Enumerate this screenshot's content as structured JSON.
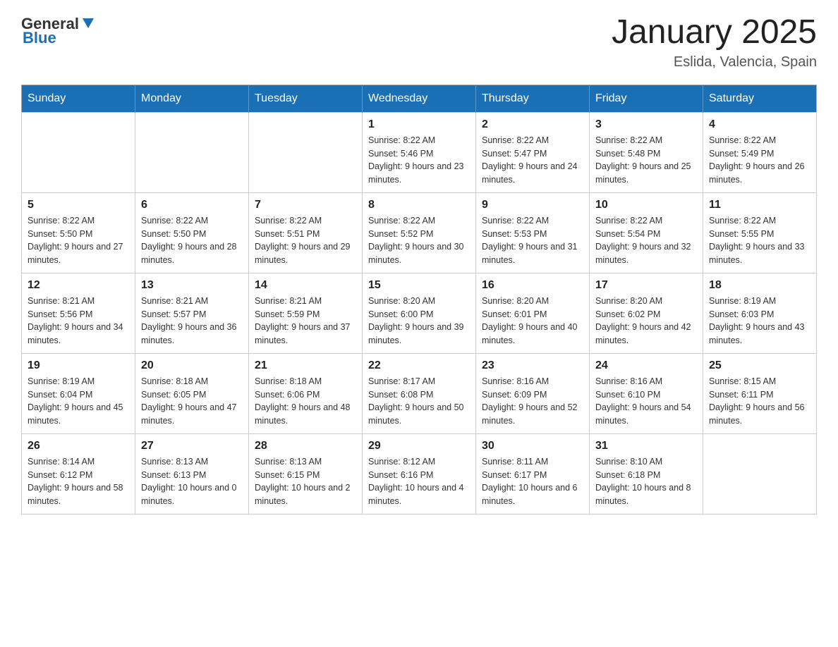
{
  "logo": {
    "text_general": "General",
    "text_blue": "Blue"
  },
  "title": "January 2025",
  "location": "Eslida, Valencia, Spain",
  "days_of_week": [
    "Sunday",
    "Monday",
    "Tuesday",
    "Wednesday",
    "Thursday",
    "Friday",
    "Saturday"
  ],
  "weeks": [
    [
      null,
      null,
      null,
      {
        "day": "1",
        "sunrise": "8:22 AM",
        "sunset": "5:46 PM",
        "daylight": "9 hours and 23 minutes."
      },
      {
        "day": "2",
        "sunrise": "8:22 AM",
        "sunset": "5:47 PM",
        "daylight": "9 hours and 24 minutes."
      },
      {
        "day": "3",
        "sunrise": "8:22 AM",
        "sunset": "5:48 PM",
        "daylight": "9 hours and 25 minutes."
      },
      {
        "day": "4",
        "sunrise": "8:22 AM",
        "sunset": "5:49 PM",
        "daylight": "9 hours and 26 minutes."
      }
    ],
    [
      {
        "day": "5",
        "sunrise": "8:22 AM",
        "sunset": "5:50 PM",
        "daylight": "9 hours and 27 minutes."
      },
      {
        "day": "6",
        "sunrise": "8:22 AM",
        "sunset": "5:50 PM",
        "daylight": "9 hours and 28 minutes."
      },
      {
        "day": "7",
        "sunrise": "8:22 AM",
        "sunset": "5:51 PM",
        "daylight": "9 hours and 29 minutes."
      },
      {
        "day": "8",
        "sunrise": "8:22 AM",
        "sunset": "5:52 PM",
        "daylight": "9 hours and 30 minutes."
      },
      {
        "day": "9",
        "sunrise": "8:22 AM",
        "sunset": "5:53 PM",
        "daylight": "9 hours and 31 minutes."
      },
      {
        "day": "10",
        "sunrise": "8:22 AM",
        "sunset": "5:54 PM",
        "daylight": "9 hours and 32 minutes."
      },
      {
        "day": "11",
        "sunrise": "8:22 AM",
        "sunset": "5:55 PM",
        "daylight": "9 hours and 33 minutes."
      }
    ],
    [
      {
        "day": "12",
        "sunrise": "8:21 AM",
        "sunset": "5:56 PM",
        "daylight": "9 hours and 34 minutes."
      },
      {
        "day": "13",
        "sunrise": "8:21 AM",
        "sunset": "5:57 PM",
        "daylight": "9 hours and 36 minutes."
      },
      {
        "day": "14",
        "sunrise": "8:21 AM",
        "sunset": "5:59 PM",
        "daylight": "9 hours and 37 minutes."
      },
      {
        "day": "15",
        "sunrise": "8:20 AM",
        "sunset": "6:00 PM",
        "daylight": "9 hours and 39 minutes."
      },
      {
        "day": "16",
        "sunrise": "8:20 AM",
        "sunset": "6:01 PM",
        "daylight": "9 hours and 40 minutes."
      },
      {
        "day": "17",
        "sunrise": "8:20 AM",
        "sunset": "6:02 PM",
        "daylight": "9 hours and 42 minutes."
      },
      {
        "day": "18",
        "sunrise": "8:19 AM",
        "sunset": "6:03 PM",
        "daylight": "9 hours and 43 minutes."
      }
    ],
    [
      {
        "day": "19",
        "sunrise": "8:19 AM",
        "sunset": "6:04 PM",
        "daylight": "9 hours and 45 minutes."
      },
      {
        "day": "20",
        "sunrise": "8:18 AM",
        "sunset": "6:05 PM",
        "daylight": "9 hours and 47 minutes."
      },
      {
        "day": "21",
        "sunrise": "8:18 AM",
        "sunset": "6:06 PM",
        "daylight": "9 hours and 48 minutes."
      },
      {
        "day": "22",
        "sunrise": "8:17 AM",
        "sunset": "6:08 PM",
        "daylight": "9 hours and 50 minutes."
      },
      {
        "day": "23",
        "sunrise": "8:16 AM",
        "sunset": "6:09 PM",
        "daylight": "9 hours and 52 minutes."
      },
      {
        "day": "24",
        "sunrise": "8:16 AM",
        "sunset": "6:10 PM",
        "daylight": "9 hours and 54 minutes."
      },
      {
        "day": "25",
        "sunrise": "8:15 AM",
        "sunset": "6:11 PM",
        "daylight": "9 hours and 56 minutes."
      }
    ],
    [
      {
        "day": "26",
        "sunrise": "8:14 AM",
        "sunset": "6:12 PM",
        "daylight": "9 hours and 58 minutes."
      },
      {
        "day": "27",
        "sunrise": "8:13 AM",
        "sunset": "6:13 PM",
        "daylight": "10 hours and 0 minutes."
      },
      {
        "day": "28",
        "sunrise": "8:13 AM",
        "sunset": "6:15 PM",
        "daylight": "10 hours and 2 minutes."
      },
      {
        "day": "29",
        "sunrise": "8:12 AM",
        "sunset": "6:16 PM",
        "daylight": "10 hours and 4 minutes."
      },
      {
        "day": "30",
        "sunrise": "8:11 AM",
        "sunset": "6:17 PM",
        "daylight": "10 hours and 6 minutes."
      },
      {
        "day": "31",
        "sunrise": "8:10 AM",
        "sunset": "6:18 PM",
        "daylight": "10 hours and 8 minutes."
      },
      null
    ]
  ],
  "labels": {
    "sunrise_prefix": "Sunrise: ",
    "sunset_prefix": "Sunset: ",
    "daylight_prefix": "Daylight: "
  }
}
